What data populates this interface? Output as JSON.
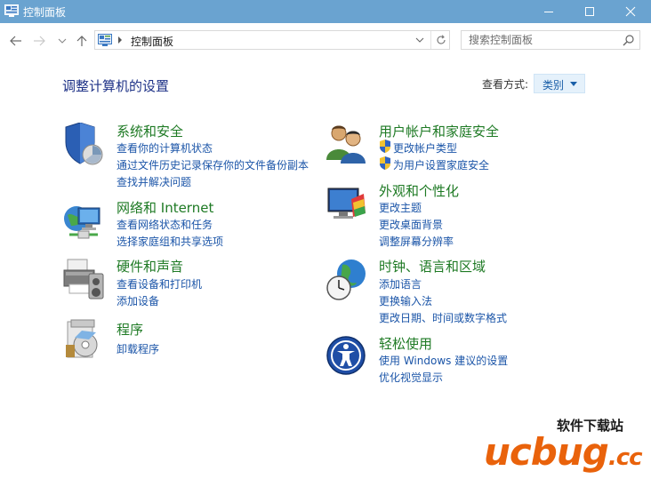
{
  "window": {
    "title": "控制面板"
  },
  "address": {
    "breadcrumb": "控制面板"
  },
  "search": {
    "placeholder": "搜索控制面板"
  },
  "main": {
    "heading": "调整计算机的设置",
    "view_by_label": "查看方式:",
    "view_by_value": "类别"
  },
  "categories": [
    {
      "title": "系统和安全",
      "icon": "system-security-icon",
      "links": [
        "查看你的计算机状态",
        "通过文件历史记录保存你的文件备份副本",
        "查找并解决问题"
      ]
    },
    {
      "title": "网络和 Internet",
      "icon": "network-internet-icon",
      "links": [
        "查看网络状态和任务",
        "选择家庭组和共享选项"
      ]
    },
    {
      "title": "硬件和声音",
      "icon": "hardware-sound-icon",
      "links": [
        "查看设备和打印机",
        "添加设备"
      ]
    },
    {
      "title": "程序",
      "icon": "programs-icon",
      "links": [
        "卸载程序"
      ]
    },
    {
      "title": "用户帐户和家庭安全",
      "icon": "user-accounts-icon",
      "links": [
        "更改帐户类型",
        "为用户设置家庭安全"
      ]
    },
    {
      "title": "外观和个性化",
      "icon": "appearance-icon",
      "links": [
        "更改主题",
        "更改桌面背景",
        "调整屏幕分辨率"
      ]
    },
    {
      "title": "时钟、语言和区域",
      "icon": "clock-language-region-icon",
      "links": [
        "添加语言",
        "更换输入法",
        "更改日期、时间或数字格式"
      ]
    },
    {
      "title": "轻松使用",
      "icon": "ease-of-access-icon",
      "links": [
        "使用 Windows 建议的设置",
        "优化视觉显示"
      ]
    }
  ],
  "watermark": {
    "top": "软件下载站",
    "bottom": "ucbug",
    "suffix": ".cc"
  },
  "colors": {
    "titlebar": "#6aa3d0",
    "category_title": "#1e7a24",
    "link": "#1b55a8",
    "heading": "#1e3287"
  }
}
